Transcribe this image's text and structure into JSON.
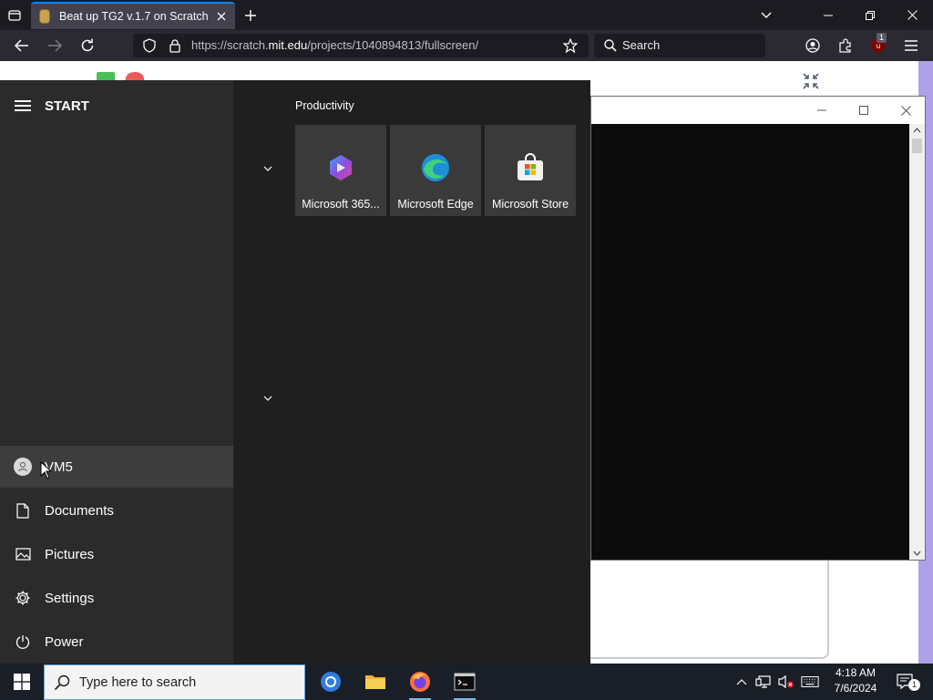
{
  "browser": {
    "tab_title": "Beat up TG2 v.1.7 on Scratch",
    "url_prefix": "https://scratch.",
    "url_domain": "mit.edu",
    "url_path": "/projects/1040894813/fullscreen/",
    "search_placeholder": "Search",
    "extension_badge": "1"
  },
  "start_menu": {
    "title": "START",
    "group_label": "Productivity",
    "tiles": [
      {
        "label": "Microsoft 365...",
        "icon": "microsoft-365-icon"
      },
      {
        "label": "Microsoft Edge",
        "icon": "edge-icon"
      },
      {
        "label": "Microsoft Store",
        "icon": "store-icon"
      }
    ],
    "side_items": [
      {
        "label": "VM5",
        "icon": "user-icon"
      },
      {
        "label": "Documents",
        "icon": "document-icon"
      },
      {
        "label": "Pictures",
        "icon": "pictures-icon"
      },
      {
        "label": "Settings",
        "icon": "gear-icon"
      },
      {
        "label": "Power",
        "icon": "power-icon"
      }
    ]
  },
  "taskbar": {
    "search_placeholder": "Type here to search",
    "apps": [
      "chrome-icon",
      "file-explorer-icon",
      "firefox-icon",
      "terminal-icon"
    ],
    "time": "4:18 AM",
    "date": "7/6/2024",
    "notification_count": "1"
  },
  "colors": {
    "browser_bg": "#1c1b22",
    "start_menu_bg": "#1f1f1f",
    "start_left_bg": "#2b2b2b",
    "tile_bg": "#3a3a3a",
    "taskbar_bg": "#1a1e26",
    "accent": "#0a84ff"
  }
}
